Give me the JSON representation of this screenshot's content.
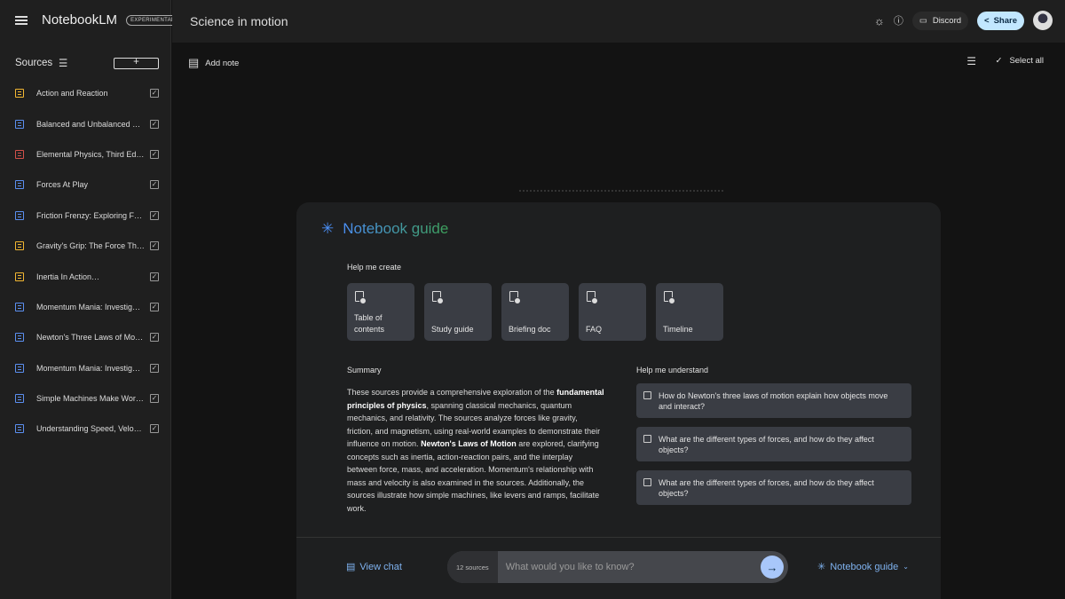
{
  "app": {
    "name": "NotebookLM",
    "badge": "EXPERIMENTAL"
  },
  "notebook": {
    "title": "Science in motion"
  },
  "header": {
    "discord_label": "Discord",
    "share_label": "Share"
  },
  "sources": {
    "title": "Sources",
    "items": [
      {
        "title": "Action and Reaction",
        "type_color": "#f2b632"
      },
      {
        "title": "Balanced and Unbalanced Forces",
        "type_color": "#5b8ff0"
      },
      {
        "title": "Elemental Physics, Third Edition",
        "type_color": "#d2504a"
      },
      {
        "title": "Forces At Play",
        "type_color": "#5b8ff0"
      },
      {
        "title": "Friction Frenzy: Exploring Friction",
        "type_color": "#5b8ff0"
      },
      {
        "title": "Gravity's Grip: The Force That Binds",
        "type_color": "#f2b632"
      },
      {
        "title": "Inertia In Action…",
        "type_color": "#f2b632"
      },
      {
        "title": "Momentum Mania: Investigating Momentum",
        "type_color": "#5b8ff0"
      },
      {
        "title": "Newton's Three Laws of Motion",
        "type_color": "#5b8ff0"
      },
      {
        "title": "Momentum Mania: Investigating Collisions",
        "type_color": "#5b8ff0"
      },
      {
        "title": "Simple Machines Make Work Easier",
        "type_color": "#5b8ff0"
      },
      {
        "title": "Understanding Speed, Velocity and Acceleration",
        "type_color": "#5b8ff0"
      }
    ]
  },
  "notes": {
    "add_note_label": "Add note",
    "select_all_label": "Select all"
  },
  "guide": {
    "title": "Notebook guide",
    "help_create_label": "Help me create",
    "create_cards": [
      "Table of contents",
      "Study guide",
      "Briefing doc",
      "FAQ",
      "Timeline"
    ],
    "summary_label": "Summary",
    "summary": [
      {
        "t": "These sources provide a comprehensive exploration of the "
      },
      {
        "t": "fundamental principles of physics",
        "b": true
      },
      {
        "t": ", spanning classical mechanics, quantum mechanics, and relativity. The sources analyze forces like gravity, friction, and magnetism, using real-world examples to demonstrate their influence on motion. "
      },
      {
        "t": "Newton's Laws of Motion",
        "b": true
      },
      {
        "t": " are explored, clarifying concepts such as inertia, action-reaction pairs, and the interplay between force, mass, and acceleration. Momentum's relationship with mass and velocity is also examined in the sources. Additionally, the sources illustrate how simple machines, like levers and ramps, facilitate work."
      }
    ],
    "help_understand_label": "Help me understand",
    "questions": [
      "How do Newton's three laws of motion explain how objects move and interact?",
      "What are the different types of forces, and how do they affect objects?",
      "What are the different types of forces, and how do they affect objects?"
    ]
  },
  "chat": {
    "view_chat_label": "View chat",
    "source_count": "12 sources",
    "placeholder": "What would you like to know?",
    "guide_button_label": "Notebook guide"
  }
}
